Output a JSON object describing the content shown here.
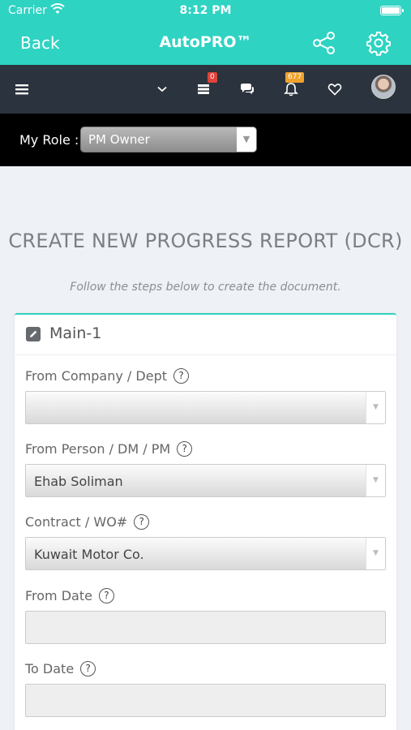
{
  "status_bar": {
    "carrier": "Carrier",
    "time": "8:12 PM"
  },
  "nav": {
    "back_label": "Back",
    "title": "AutoPRO™"
  },
  "toolbar": {
    "inbox_badge": "0",
    "notifications_badge": "677"
  },
  "role": {
    "label": "My Role :",
    "value": "PM Owner"
  },
  "page": {
    "title": "CREATE NEW PROGRESS REPORT (DCR)",
    "subtitle": "Follow the steps below to create the document."
  },
  "card": {
    "title": "Main-1",
    "fields": [
      {
        "label": "From Company / Dept",
        "type": "select",
        "value": ""
      },
      {
        "label": "From Person / DM / PM",
        "type": "select",
        "value": "Ehab Soliman"
      },
      {
        "label": "Contract / WO#",
        "type": "select",
        "value": "Kuwait Motor Co."
      },
      {
        "label": "From Date",
        "type": "text",
        "value": ""
      },
      {
        "label": "To Date",
        "type": "text",
        "value": ""
      }
    ]
  },
  "colors": {
    "accent": "#2ed3c2",
    "toolbar": "#2b333e",
    "role_bar": "#000000",
    "badge_red": "#e0433a",
    "badge_orange": "#f2a22c"
  }
}
